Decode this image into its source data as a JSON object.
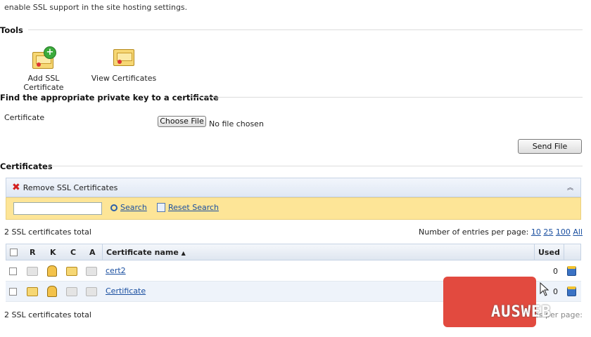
{
  "intro_text": "enable SSL support in the site hosting settings.",
  "tools": {
    "title": "Tools",
    "add_label": "Add SSL Certificate",
    "view_label": "View Certificates"
  },
  "private_key": {
    "title": "Find the appropriate private key to a certificate",
    "field_label": "Certificate",
    "choose_label": "Choose File",
    "no_file": "No file chosen",
    "send_label": "Send File"
  },
  "certificates": {
    "title": "Certificates",
    "remove_label": "Remove SSL Certificates",
    "search_label": "Search",
    "reset_label": "Reset Search",
    "search_value": "",
    "total_top": "2 SSL certificates total",
    "total_bottom": "2 SSL certificates total",
    "entries_label": "Number of entries per page:",
    "entries_bottom_label": "Number of entries per page:",
    "page_options": [
      "10",
      "25",
      "100",
      "All"
    ],
    "columns": {
      "r": "R",
      "k": "K",
      "c": "C",
      "a": "A",
      "name": "Certificate name",
      "sort_arrow": "▲",
      "used": "Used"
    },
    "rows": [
      {
        "name": "cert2",
        "used": "0"
      },
      {
        "name": "Certificate",
        "used": "0"
      }
    ]
  },
  "watermark": "AUSWEB",
  "colors": {
    "link": "#1a4fa0",
    "search_bar": "#fde597",
    "toolbar": "#e0e8f4",
    "watermark": "#e24a3f"
  }
}
